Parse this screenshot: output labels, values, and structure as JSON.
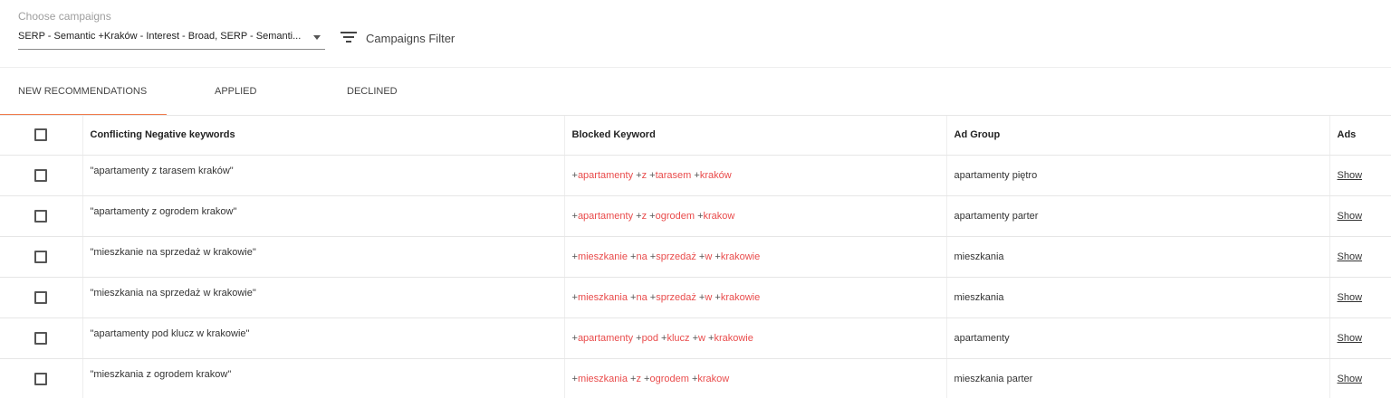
{
  "header": {
    "campaigns_label": "Choose campaigns",
    "campaigns_value": "SERP - Semantic +Kraków - Interest - Broad, SERP - Semanti...",
    "filter_label": "Campaigns Filter"
  },
  "tabs": [
    {
      "label": "NEW RECOMMENDATIONS",
      "active": true
    },
    {
      "label": "APPLIED",
      "active": false
    },
    {
      "label": "DECLINED",
      "active": false
    }
  ],
  "colors": {
    "accent": "#f07a4a",
    "keyword": "#e94b4b"
  },
  "table": {
    "columns": [
      "Conflicting Negative keywords",
      "Blocked Keyword",
      "Ad Group",
      "Ads"
    ],
    "rows": [
      {
        "negative": "\"apartamenty z tarasem kraków\"",
        "blocked": [
          "apartamenty",
          "z",
          "tarasem",
          "kraków"
        ],
        "ad_group": "apartamenty piętro",
        "ads": "Show"
      },
      {
        "negative": "\"apartamenty z ogrodem krakow\"",
        "blocked": [
          "apartamenty",
          "z",
          "ogrodem",
          "krakow"
        ],
        "ad_group": "apartamenty parter",
        "ads": "Show"
      },
      {
        "negative": "\"mieszkanie na sprzedaż w krakowie\"",
        "blocked": [
          "mieszkanie",
          "na",
          "sprzedaż",
          "w",
          "krakowie"
        ],
        "ad_group": "mieszkania",
        "ads": "Show"
      },
      {
        "negative": "\"mieszkania na sprzedaż w krakowie\"",
        "blocked": [
          "mieszkania",
          "na",
          "sprzedaż",
          "w",
          "krakowie"
        ],
        "ad_group": "mieszkania",
        "ads": "Show"
      },
      {
        "negative": "\"apartamenty pod klucz w krakowie\"",
        "blocked": [
          "apartamenty",
          "pod",
          "klucz",
          "w",
          "krakowie"
        ],
        "ad_group": "apartamenty",
        "ads": "Show"
      },
      {
        "negative": "\"mieszkania z ogrodem krakow\"",
        "blocked": [
          "mieszkania",
          "z",
          "ogrodem",
          "krakow"
        ],
        "ad_group": "mieszkania parter",
        "ads": "Show"
      }
    ]
  }
}
